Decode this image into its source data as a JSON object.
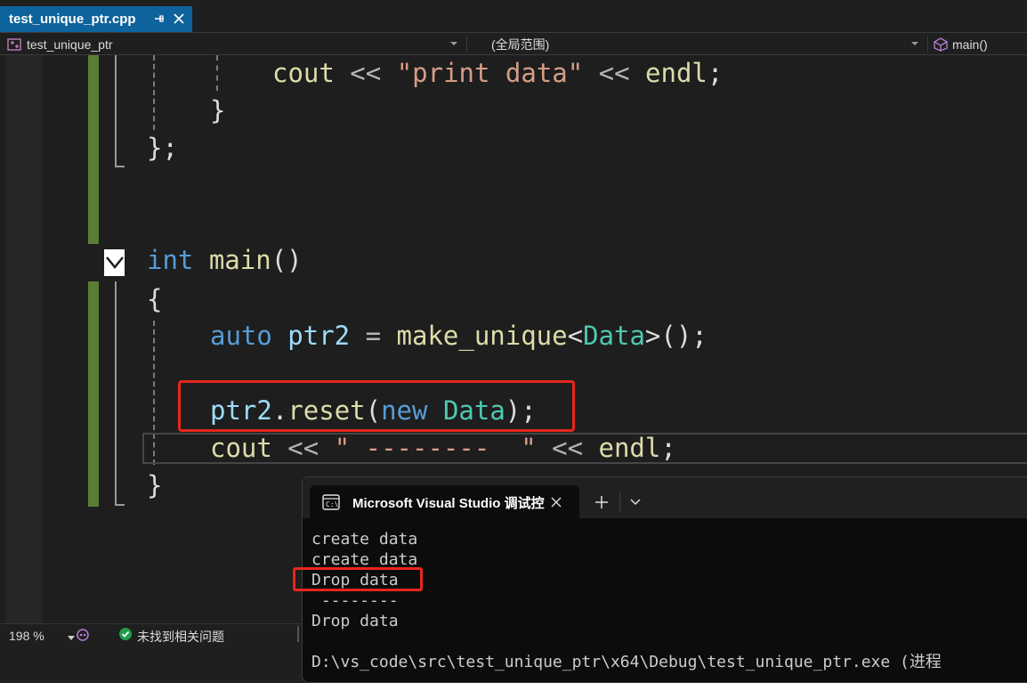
{
  "tab": {
    "title": "test_unique_ptr.cpp"
  },
  "navbar": {
    "project": "test_unique_ptr",
    "scope": "(全局范围)",
    "member": "main()"
  },
  "code": {
    "line1": {
      "fn": "cout",
      "op1": " << ",
      "str": "\"print data\"",
      "op2": " << ",
      "fn2": "endl",
      "end": ";"
    },
    "line2": "}",
    "line3": "};",
    "line4": {
      "kw": "int",
      "fn": " main",
      "rest": "()"
    },
    "line5": "{",
    "line6": {
      "kw": "auto",
      "var": " ptr2",
      "op": " = ",
      "fn": "make_unique",
      "lt": "<",
      "ty": "Data",
      "gt": ">",
      "rest": "();"
    },
    "line7": {
      "var": "ptr2",
      "dot": ".",
      "fn": "reset",
      "p1": "(",
      "kw": "new",
      "sp": " ",
      "ty": "Data",
      "end": ");"
    },
    "line8": {
      "fn": "cout",
      "op1": " << ",
      "str": "\" --------  \"",
      "op2": " << ",
      "fn2": "endl",
      "end": ";"
    },
    "line9": "}"
  },
  "console": {
    "title": "Microsoft Visual Studio 调试控",
    "lines": [
      "create data",
      "create data",
      "Drop data",
      " --------",
      "Drop data",
      "",
      "D:\\vs_code\\src\\test_unique_ptr\\x64\\Debug\\test_unique_ptr.exe (进程"
    ]
  },
  "status": {
    "zoom": "198 %",
    "message": "未找到相关问题"
  },
  "colors": {
    "accent": "#0e639c",
    "keyword": "#569cd6",
    "string": "#d69d85",
    "function": "#dcdcaa",
    "type": "#4ec9b0",
    "variable": "#9cdcfe",
    "highlight": "#e8261c",
    "change_bar": "#5a7d36"
  }
}
